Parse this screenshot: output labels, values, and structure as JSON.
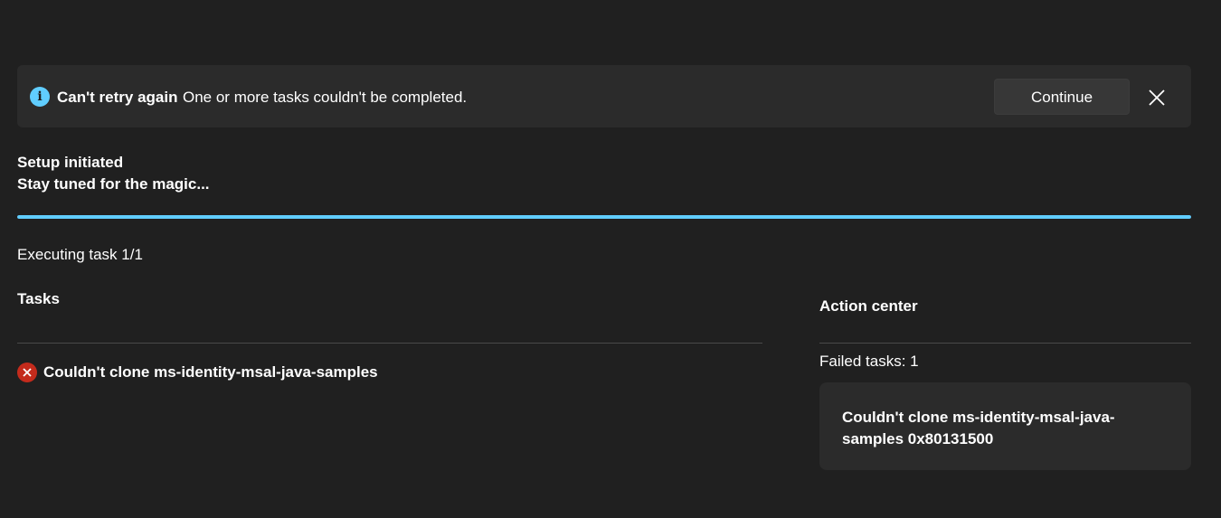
{
  "infobar": {
    "icon": "info-icon",
    "title": "Can't retry again",
    "message": "One or more tasks couldn't be completed.",
    "continue_label": "Continue",
    "close_icon": "close-icon"
  },
  "header": {
    "title": "Setup initiated",
    "subtitle": "Stay tuned for the magic..."
  },
  "progress": {
    "percent": 100,
    "color": "#60cdff"
  },
  "status": {
    "executing": "Executing task 1/1"
  },
  "tasks": {
    "heading": "Tasks",
    "items": [
      {
        "icon": "error-icon",
        "label": "Couldn't clone ms-identity-msal-java-samples",
        "status_color": "#c42b1c"
      }
    ]
  },
  "action_center": {
    "heading": "Action center",
    "failed_count": "Failed tasks: 1",
    "failed_items": [
      {
        "text": "Couldn't clone ms-identity-msal-java-samples 0x80131500"
      }
    ]
  },
  "colors": {
    "background": "#202020",
    "surface": "#2b2b2b",
    "accent": "#60cdff",
    "error": "#c42b1c"
  }
}
